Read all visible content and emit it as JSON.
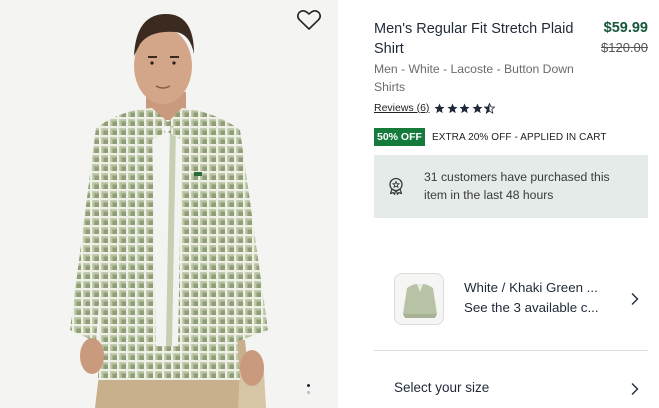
{
  "product": {
    "title": "Men's Regular Fit Stretch Plaid Shirt",
    "price": "$59.99",
    "original_price": "$120.00",
    "subtitle": "Men - White - Lacoste - Button Down Shirts",
    "reviews_label": "Reviews (6)",
    "rating": 4.5,
    "rating_max": 5
  },
  "promo": {
    "badge": "50% OFF",
    "text": "EXTRA 20% OFF - APPLIED IN CART"
  },
  "social_proof": {
    "text": "31 customers have purchased this item in the last 48 hours",
    "icon": "badge-ribbon-icon"
  },
  "variant": {
    "color_name": "White / Khaki Green ...",
    "available_text": "See the 3 available c..."
  },
  "size_selector": {
    "label": "Select your size"
  },
  "gallery": {
    "icons": {
      "wishlist": "heart-icon"
    },
    "total_slides": 2,
    "active_slide": 1
  },
  "colors": {
    "brand_green": "#157b3c",
    "price_green": "#17583a",
    "panel_bg": "#e4ebe8"
  }
}
